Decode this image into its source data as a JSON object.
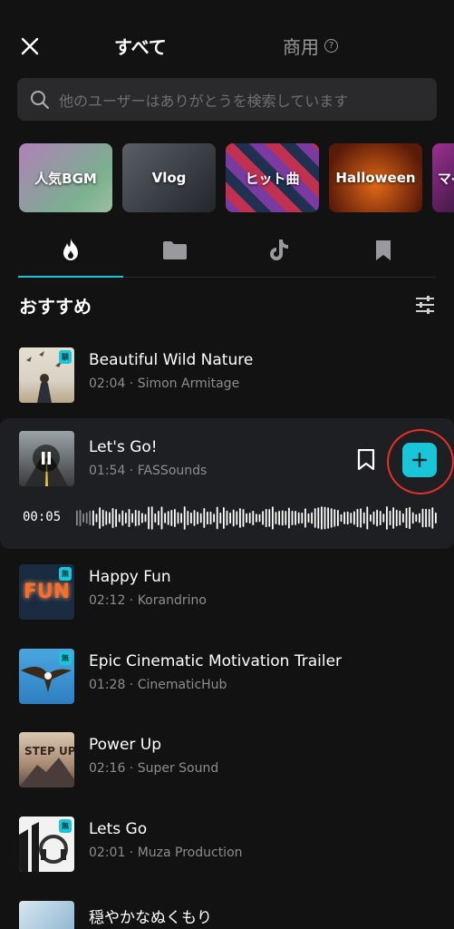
{
  "header": {
    "tab_all": "すべて",
    "tab_commercial": "商用",
    "help_symbol": "?"
  },
  "search": {
    "placeholder": "他のユーザーはありがとうを検索しています"
  },
  "categories": [
    "人気BGM",
    "Vlog",
    "ヒット曲",
    "Halloween",
    "マ-"
  ],
  "icon_tabs": [
    "flame-icon",
    "folder-icon",
    "tiktok-icon",
    "bookmark-icon"
  ],
  "section": {
    "title": "おすすめ"
  },
  "tracks": [
    {
      "title": "Beautiful Wild Nature",
      "meta": "02:04 · Simon Armitage",
      "badge": "験"
    },
    {
      "title": "Let's Go!",
      "meta": "01:54 · FASSounds",
      "current_time": "00:05"
    },
    {
      "title": "Happy Fun",
      "meta": "02:12 · Korandrino",
      "badge": "無"
    },
    {
      "title": "Epic Cinematic Motivation Trailer",
      "meta": "01:28 · CinematicHub",
      "badge": "無"
    },
    {
      "title": "Power Up",
      "meta": "02:16 · Super Sound"
    },
    {
      "title": "Lets Go",
      "meta": "02:01 · Muza Production",
      "badge": "無"
    },
    {
      "title": "穏やかなぬくもり",
      "meta": ""
    }
  ],
  "thumb_text": {
    "fun": "FUN",
    "step_up": "STEP UP"
  },
  "colors": {
    "accent": "#19c5d8",
    "highlight_ring": "#e8302a",
    "background": "#121212"
  }
}
